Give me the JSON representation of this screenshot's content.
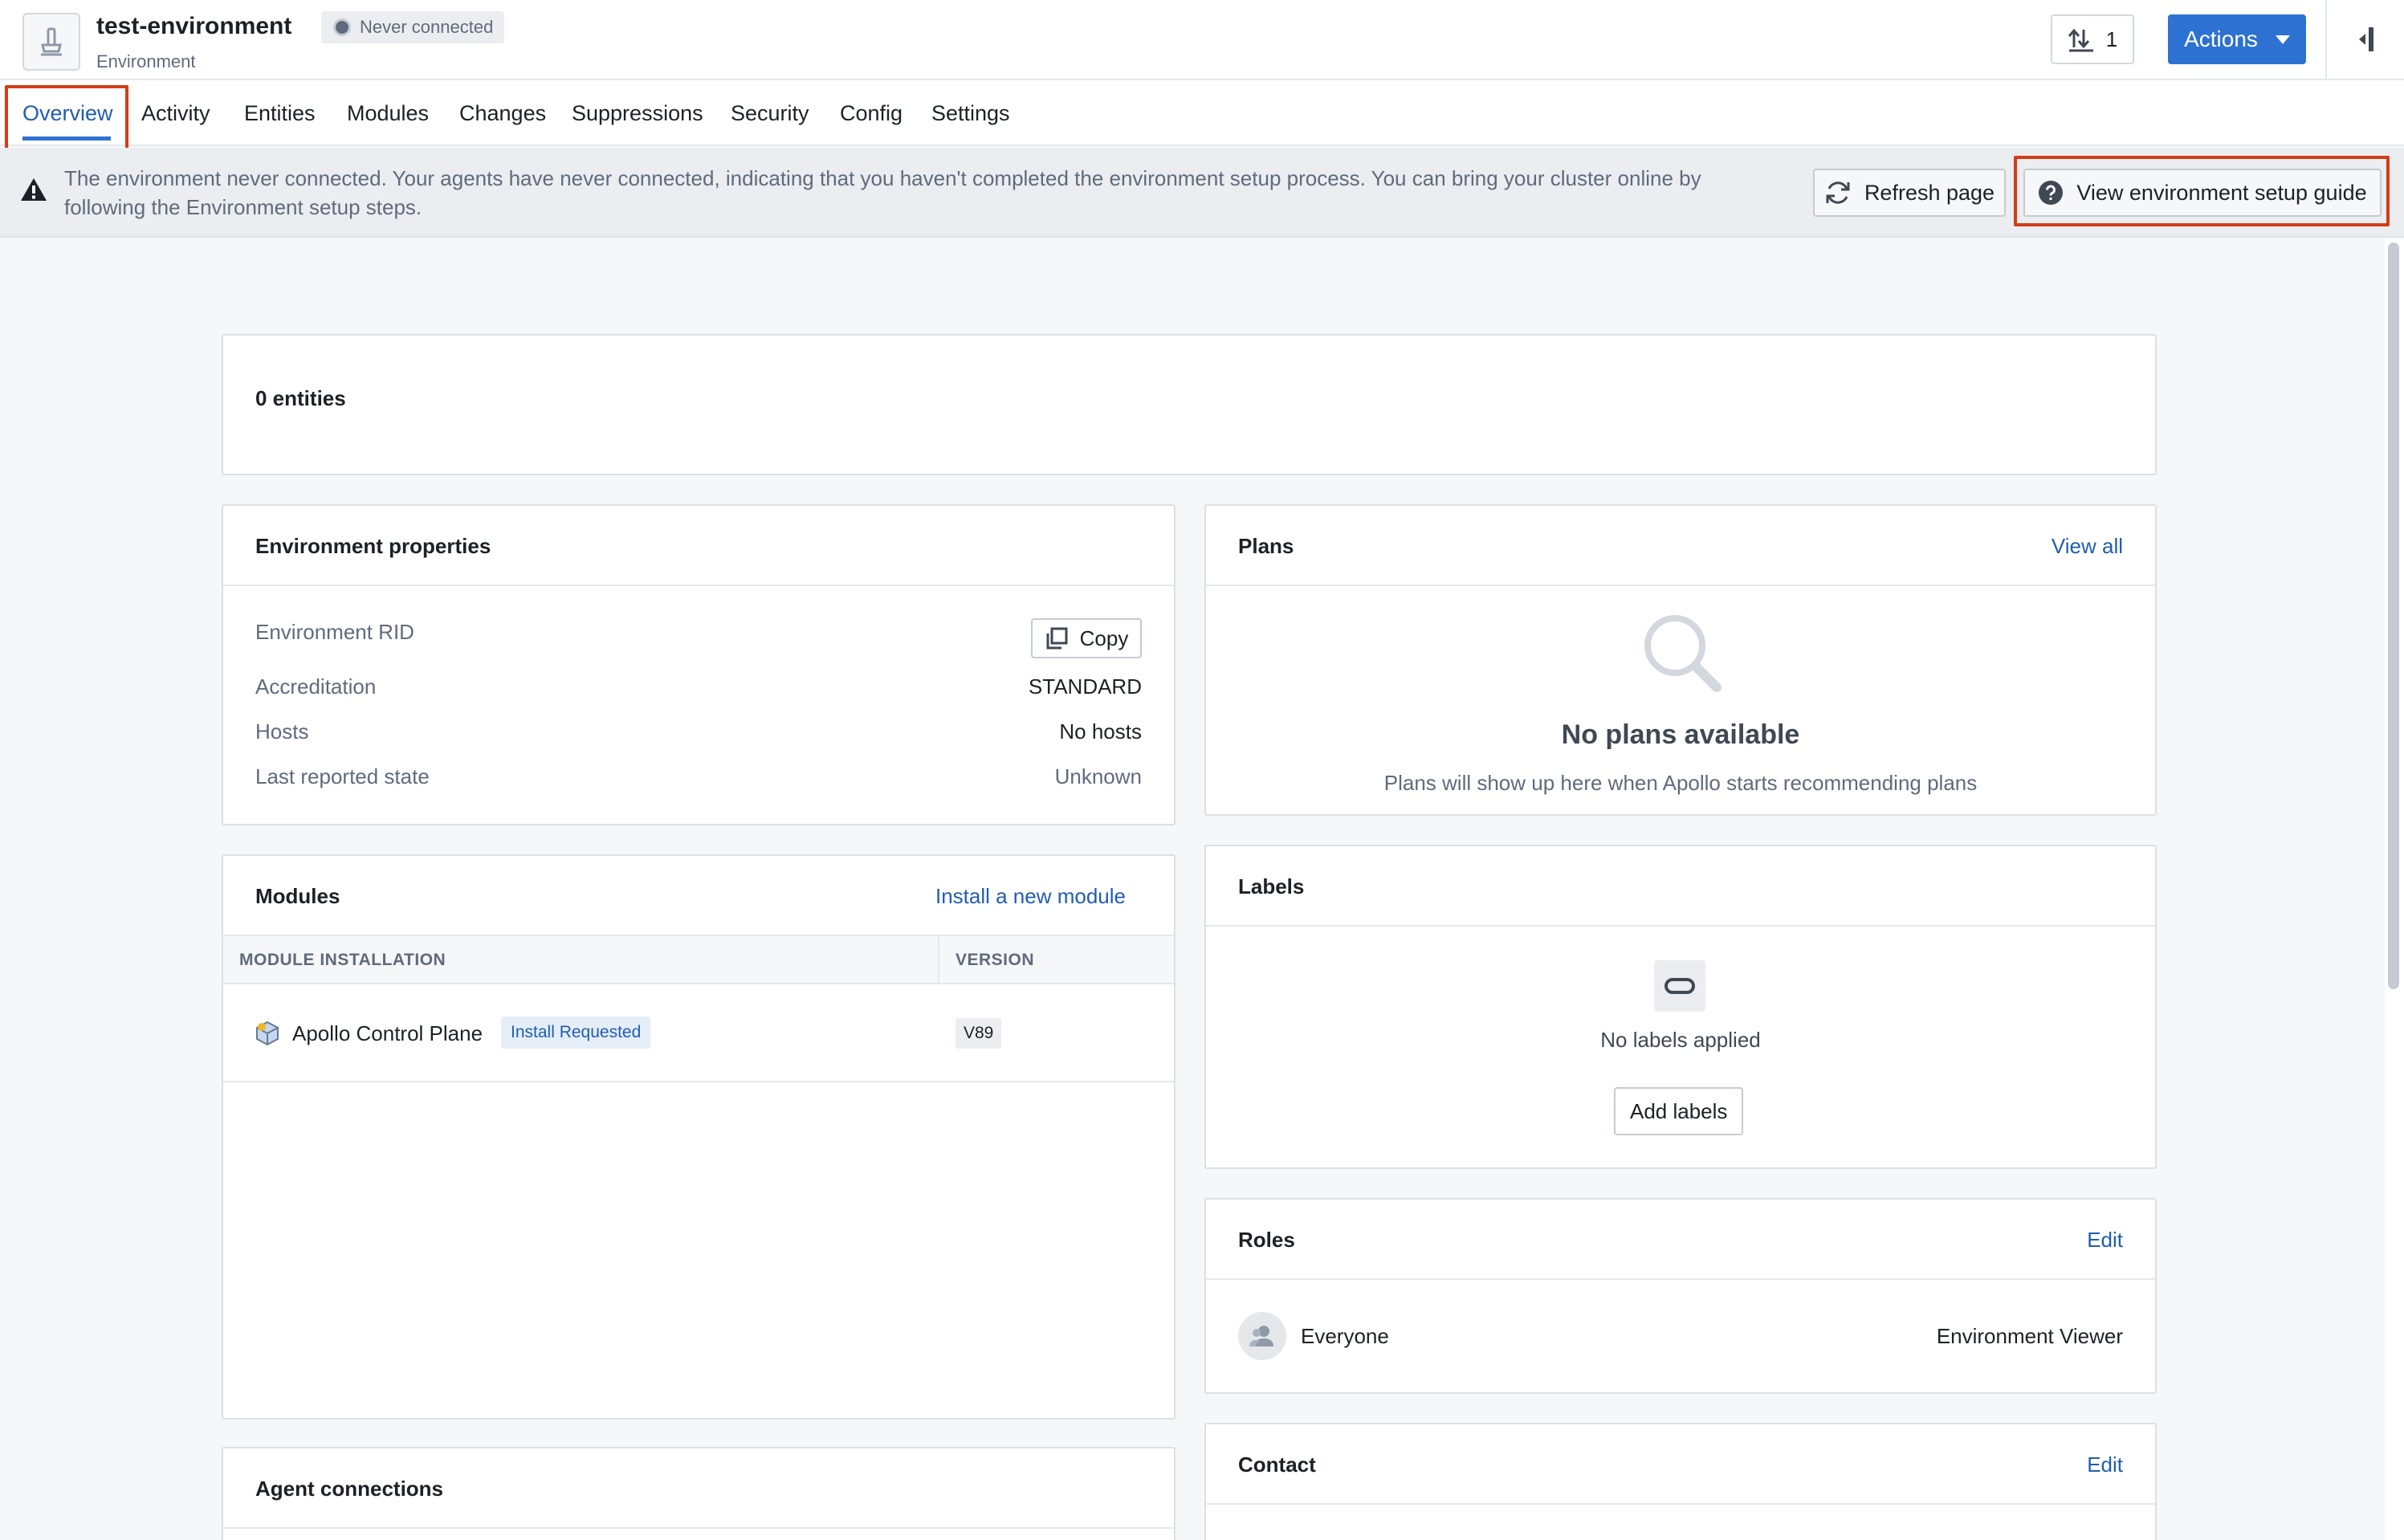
{
  "header": {
    "title": "test-environment",
    "subtitle": "Environment",
    "status": "Never connected",
    "count": "1",
    "actions_label": "Actions"
  },
  "tabs": [
    {
      "label": "Overview",
      "active": true
    },
    {
      "label": "Activity"
    },
    {
      "label": "Entities"
    },
    {
      "label": "Modules"
    },
    {
      "label": "Changes"
    },
    {
      "label": "Suppressions"
    },
    {
      "label": "Security"
    },
    {
      "label": "Config"
    },
    {
      "label": "Settings"
    }
  ],
  "banner": {
    "message": "The environment never connected. Your agents have never connected, indicating that you haven't completed the environment setup process. You can bring your cluster online by following the Environment setup steps.",
    "refresh_label": "Refresh page",
    "guide_label": "View environment setup guide"
  },
  "entities": {
    "summary": "0 entities"
  },
  "properties": {
    "title": "Environment properties",
    "rows": [
      {
        "label": "Environment RID",
        "value": ""
      },
      {
        "label": "Accreditation",
        "value": "STANDARD"
      },
      {
        "label": "Hosts",
        "value": "No hosts"
      },
      {
        "label": "Last reported state",
        "value": "Unknown"
      }
    ],
    "copy_label": "Copy"
  },
  "modules": {
    "title": "Modules",
    "install_link": "Install a new module",
    "columns": [
      "MODULE INSTALLATION",
      "VERSION"
    ],
    "rows": [
      {
        "name": "Apollo Control Plane",
        "status": "Install Requested",
        "version": "V89"
      }
    ]
  },
  "agents": {
    "title": "Agent connections"
  },
  "plans": {
    "title": "Plans",
    "view_all": "View all",
    "empty_title": "No plans available",
    "empty_sub": "Plans will show up here when Apollo starts recommending plans"
  },
  "labels": {
    "title": "Labels",
    "empty": "No labels applied",
    "add_label": "Add labels"
  },
  "roles": {
    "title": "Roles",
    "edit": "Edit",
    "rows": [
      {
        "principal": "Everyone",
        "role": "Environment Viewer"
      }
    ]
  },
  "contact": {
    "title": "Contact",
    "edit": "Edit"
  },
  "colors": {
    "accent": "#2d72d2",
    "link": "#215db0",
    "highlight": "#d33d17",
    "muted": "#5f6b7c"
  },
  "icons": [
    "environment-icon",
    "status-dot-icon",
    "upload-icon",
    "caret-down-icon",
    "panel-collapse-icon",
    "warning-icon",
    "refresh-icon",
    "help-icon",
    "copy-icon",
    "module-icon",
    "search-icon",
    "label-icon",
    "user-icon"
  ]
}
